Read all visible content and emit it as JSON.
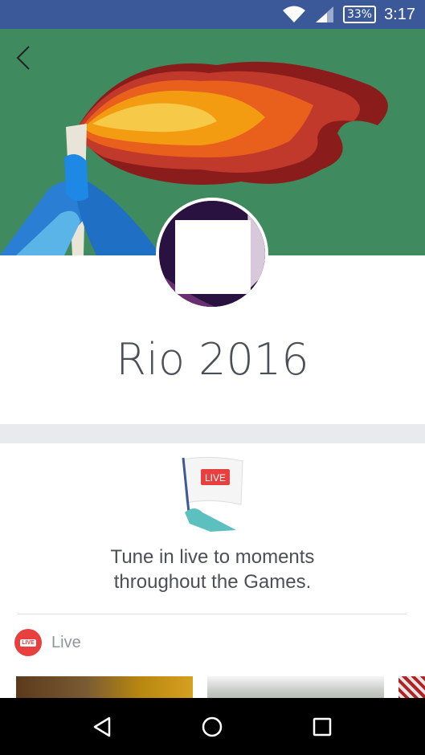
{
  "status_bar": {
    "battery_text": "33%",
    "time": "3:17",
    "icons": [
      "wifi-icon",
      "cell-signal-icon",
      "battery-icon"
    ]
  },
  "header": {
    "back_icon": "back-chevron-icon"
  },
  "page": {
    "title": "Rio 2016"
  },
  "promo": {
    "flag_label": "LIVE",
    "text_line1": "Tune in live to moments",
    "text_line2": "throughout the Games."
  },
  "live_section": {
    "badge_label": "LIVE",
    "label": "Live"
  },
  "nav": {
    "icons": [
      "back-triangle-icon",
      "home-circle-icon",
      "recents-square-icon"
    ]
  },
  "colors": {
    "status_bar": "#3b5998",
    "cover_bg": "#3f8a5e",
    "live_red": "#e8403e",
    "title_text": "#4b4f56",
    "divider": "#e9eaee"
  }
}
